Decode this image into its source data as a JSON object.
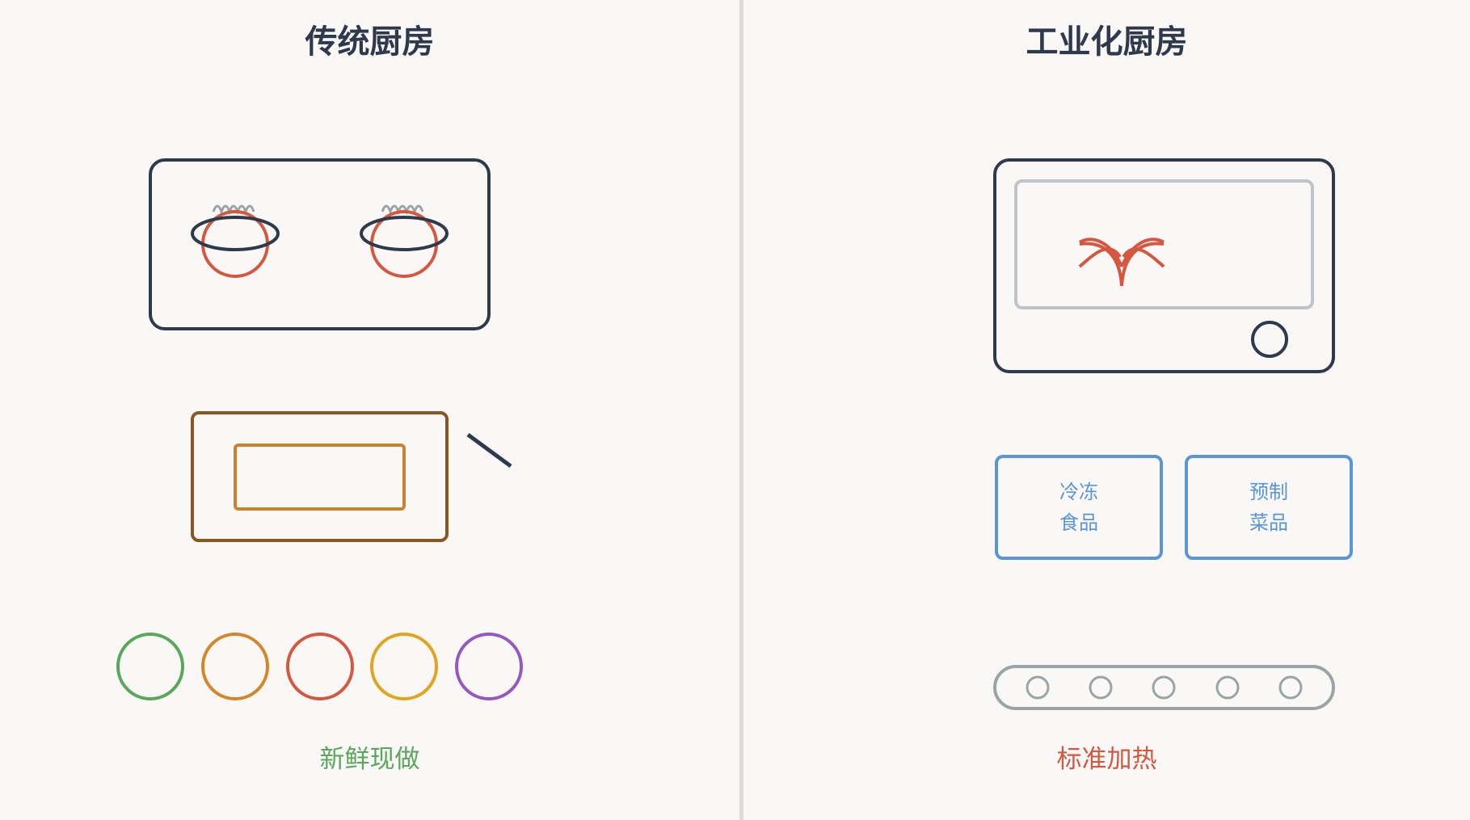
{
  "left": {
    "title": "传统厨房",
    "caption": "新鲜现做",
    "caption_color": "#5aa65a",
    "ingredient_colors": [
      "#5aa65a",
      "#d4862a",
      "#d4573f",
      "#e0a51c",
      "#9558c0"
    ]
  },
  "right": {
    "title": "工业化厨房",
    "caption": "标准加热",
    "caption_color": "#d4573f",
    "packages": [
      {
        "line1": "冷冻",
        "line2": "食品"
      },
      {
        "line1": "预制",
        "line2": "菜品"
      }
    ],
    "package_color": "#5a95d6"
  },
  "colors": {
    "outline": "#2e3a4c",
    "burner": "#d4573f",
    "steam": "#9aa4a4",
    "board_outer": "#8a5520",
    "board_inner": "#c9832e",
    "microwave_window": "#bec4c8",
    "conveyor": "#9aa4a4"
  }
}
